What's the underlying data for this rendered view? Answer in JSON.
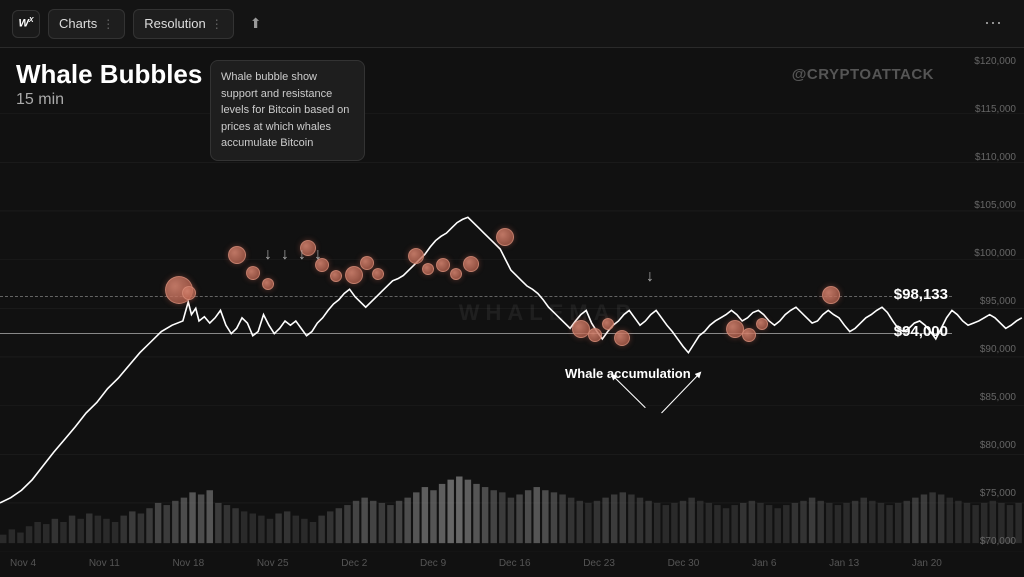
{
  "topbar": {
    "logo": "WX",
    "charts_label": "Charts",
    "resolution_label": "Resolution",
    "more_icon": "⋯"
  },
  "chart": {
    "title": "Whale Bubbles",
    "subtitle": "15 min",
    "tooltip": "Whale bubble show support and resistance levels for Bitcoin based on prices at which whales accumulate Bitcoin",
    "twitter": "@CRYPTOATTACK",
    "watermark": "WHALEMAP",
    "price_line_1": "$98,133",
    "price_line_2": "$94,000",
    "whale_accumulation_label": "Whale\naccumulation",
    "y_axis_labels": [
      "$120,000",
      "$115,000",
      "$110,000",
      "$105,000",
      "$100,000",
      "$95,000",
      "$90,000",
      "$85,000",
      "$80,000",
      "$75,000",
      "$70,000"
    ],
    "x_axis_labels": [
      "Nov 4",
      "Nov 11",
      "Nov 18",
      "Nov 25",
      "Dec 2",
      "Dec 9",
      "Dec 16",
      "Dec 23",
      "Dec 30",
      "Jan 6",
      "Jan 13",
      "Jan 20"
    ]
  }
}
